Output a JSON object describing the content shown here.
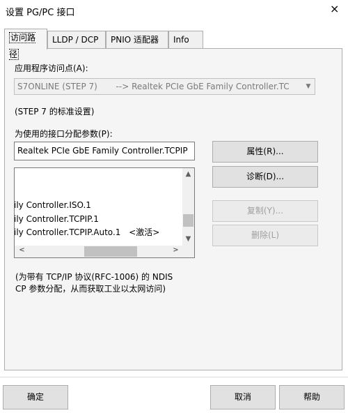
{
  "window": {
    "title": "设置 PG/PC 接口"
  },
  "tabs": [
    {
      "label": "访问路径",
      "active": true
    },
    {
      "label": "LLDP / DCP",
      "active": false
    },
    {
      "label": "PNIO 适配器",
      "active": false
    },
    {
      "label": "Info",
      "active": false
    }
  ],
  "access_point": {
    "label": "应用程序访问点(A):",
    "value": "S7ONLINE (STEP 7)       --> Realtek PCIe GbE Family Controller.TC",
    "note": "(STEP 7 的标准设置)"
  },
  "params": {
    "label": "为使用的接口分配参数(P):",
    "value": "Realtek PCIe GbE Family Controller.TCPIP",
    "list_items": [
      "ily Controller.ISO.1",
      "ily Controller.TCPIP.1",
      "ily Controller.TCPIP.Auto.1"
    ],
    "active_tag": "<激活>"
  },
  "buttons": {
    "properties": "属性(R)...",
    "diagnostics": "诊断(D)...",
    "copy": "复制(Y)...",
    "delete": "删除(L)"
  },
  "description": {
    "line1": "(为带有 TCP/IP 协议(RFC-1006) 的 NDIS",
    "line2": "CP 参数分配，从而获取工业以太网访问)"
  },
  "footer": {
    "ok": "确定",
    "cancel": "取消",
    "help": "帮助"
  },
  "icons": {
    "close": "×",
    "dropdown": "▼",
    "scroll_up": "▲",
    "scroll_down": "▼",
    "scroll_left": "<",
    "scroll_right": ">"
  }
}
